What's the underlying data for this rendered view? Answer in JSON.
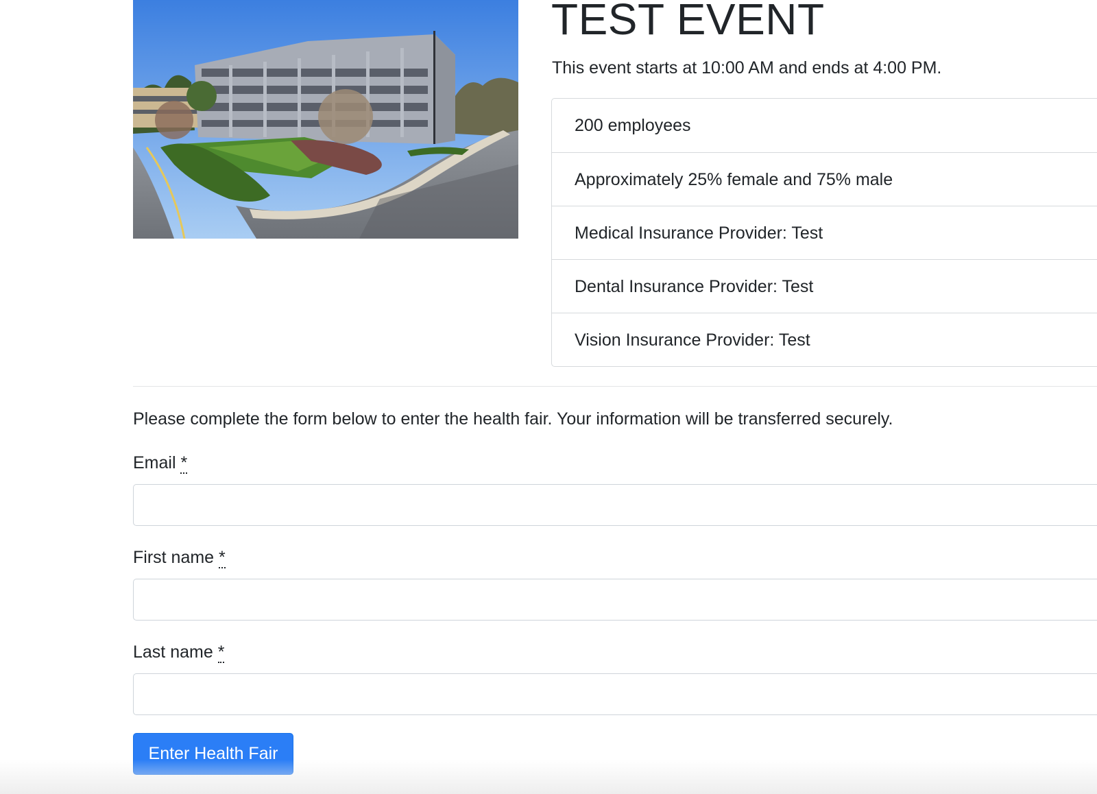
{
  "event": {
    "title": "TEST EVENT",
    "time_text": "This event starts at 10:00 AM and ends at 4:00 PM.",
    "photo_alt": "building-photo"
  },
  "details": [
    "200 employees",
    "Approximately 25% female and 75% male",
    "Medical Insurance Provider: Test",
    "Dental Insurance Provider: Test",
    "Vision Insurance Provider: Test"
  ],
  "form": {
    "intro": "Please complete the form below to enter the health fair. Your information will be transferred securely.",
    "required_marker": "*",
    "fields": {
      "email": {
        "label": "Email",
        "value": ""
      },
      "first_name": {
        "label": "First name",
        "value": ""
      },
      "last_name": {
        "label": "Last name",
        "value": ""
      }
    },
    "submit_label": "Enter Health Fair"
  },
  "colors": {
    "primary_button": "#2b7ef6",
    "text": "#212529",
    "border": "#d6d9dc"
  }
}
